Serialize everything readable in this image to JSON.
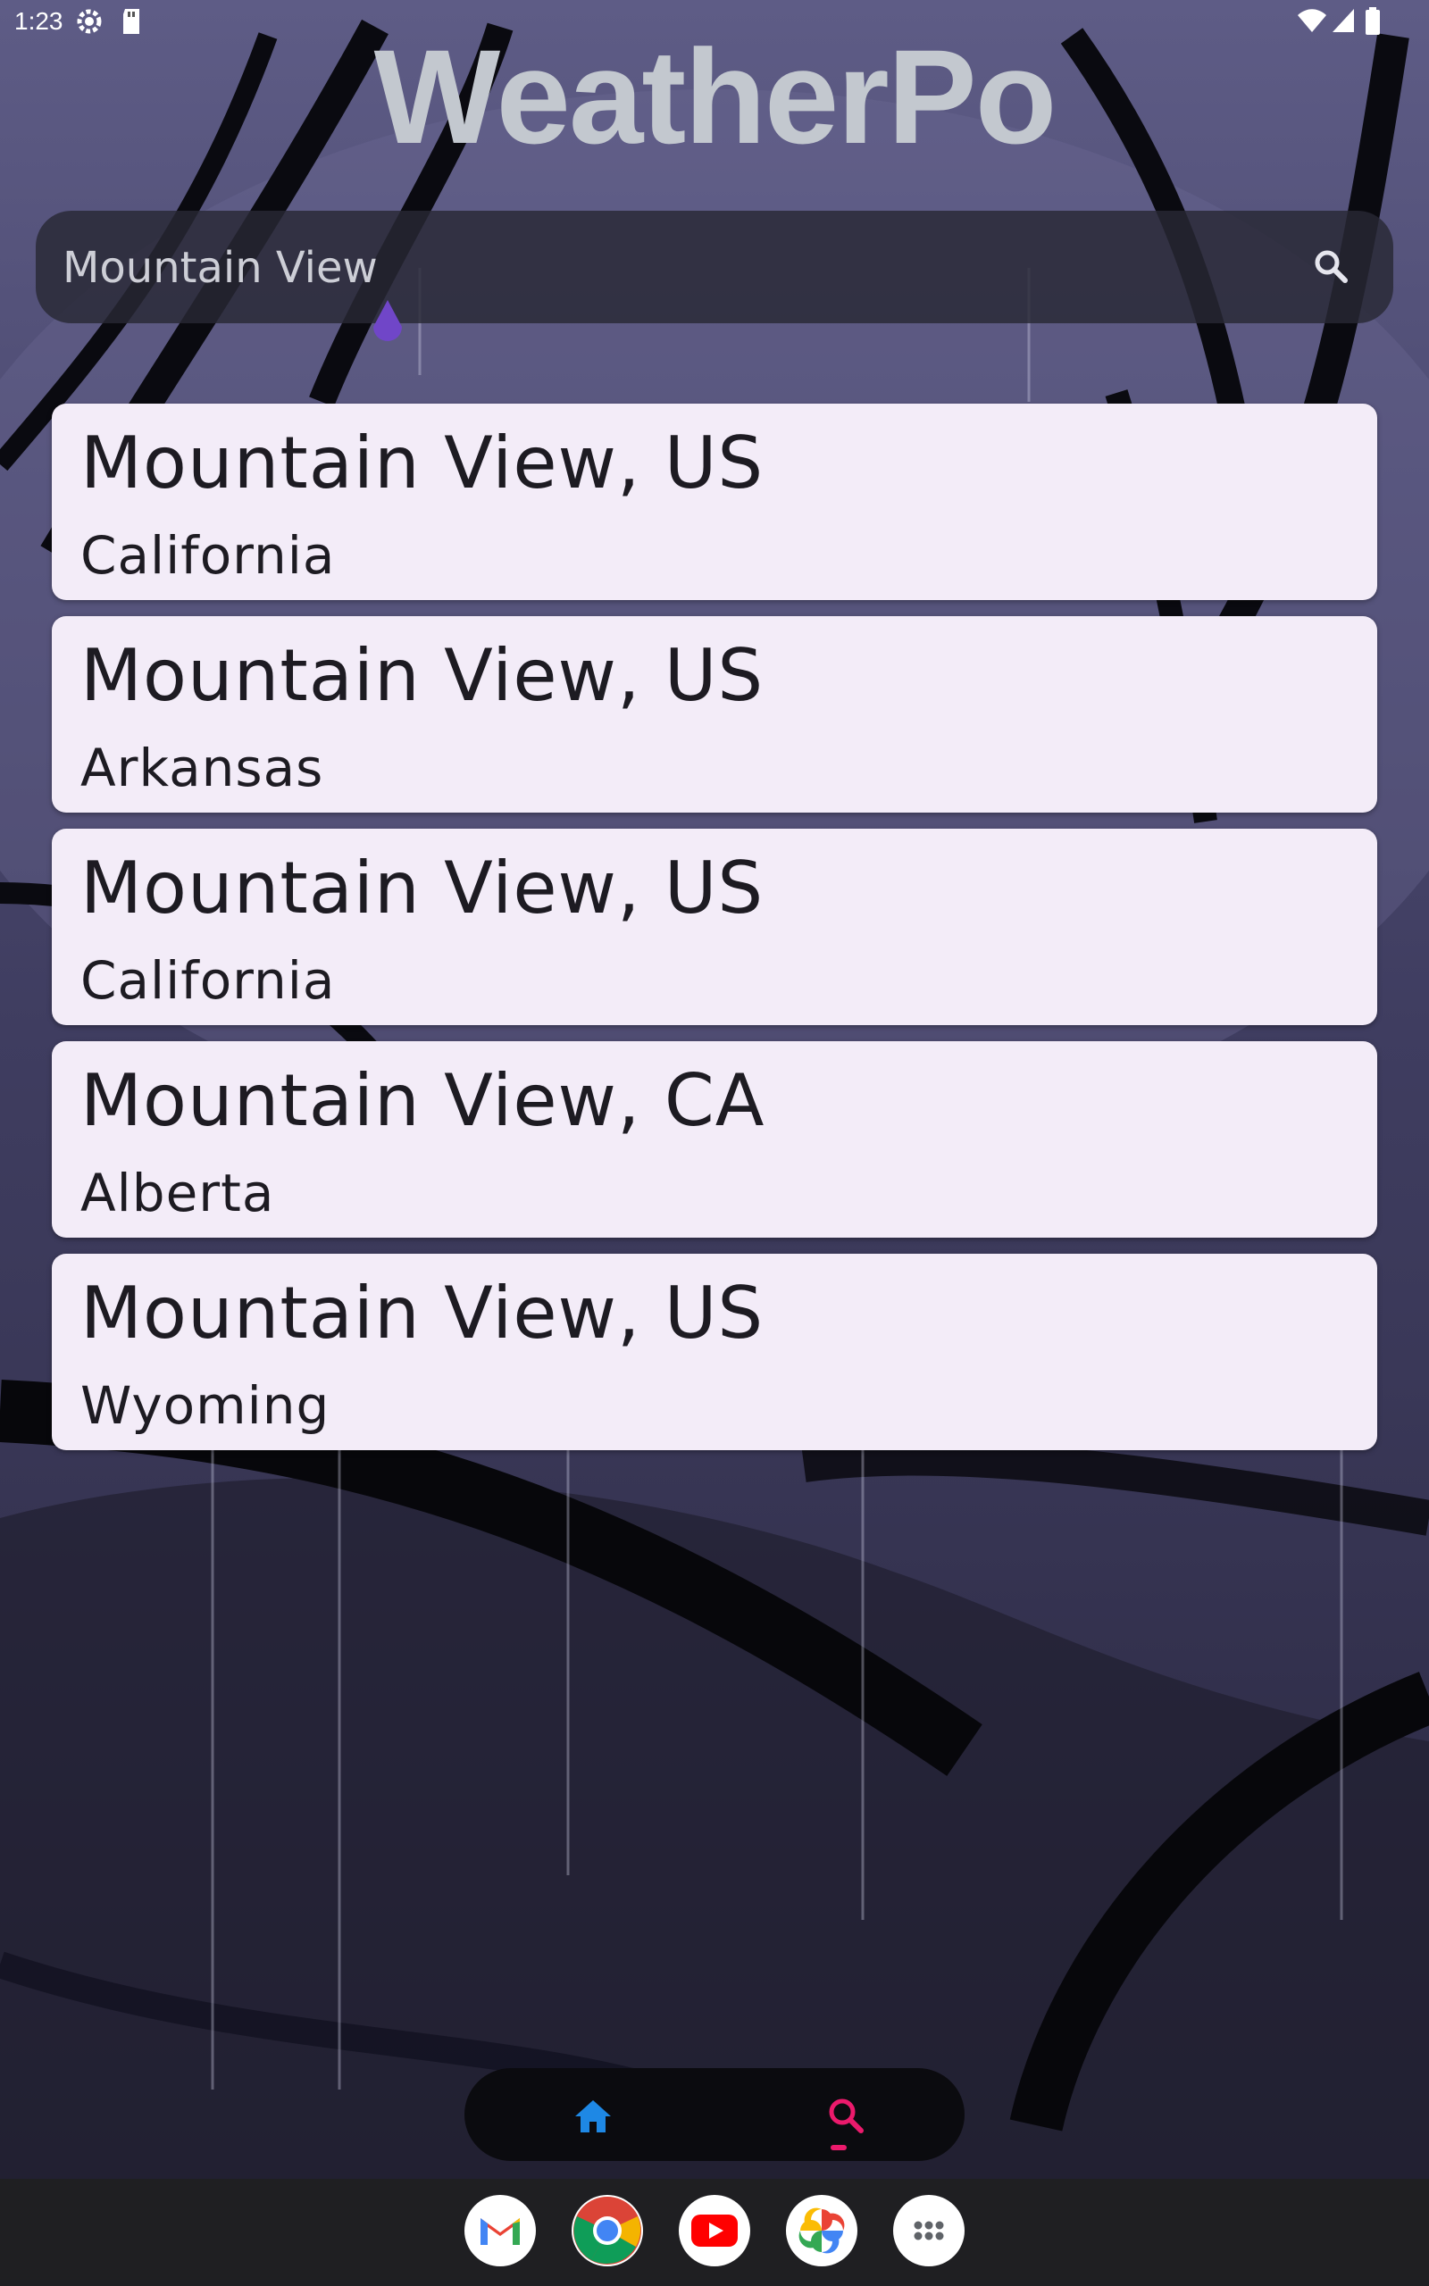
{
  "status_bar": {
    "time": "1:23",
    "left_icons": [
      "settings-icon",
      "sd-card-icon"
    ],
    "right_icons": [
      "wifi-icon",
      "signal-icon",
      "battery-icon"
    ]
  },
  "app": {
    "title": "WeatherPo"
  },
  "search": {
    "value": "Mountain View",
    "button_icon": "search-icon"
  },
  "results": [
    {
      "city": "Mountain View, US",
      "region": "California"
    },
    {
      "city": "Mountain View, US",
      "region": "Arkansas"
    },
    {
      "city": "Mountain View, US",
      "region": "California"
    },
    {
      "city": "Mountain View, CA",
      "region": "Alberta"
    },
    {
      "city": "Mountain View, US",
      "region": "Wyoming"
    }
  ],
  "bottom_nav": {
    "items": [
      {
        "icon": "home-icon",
        "color": "#1e88e5",
        "selected": false
      },
      {
        "icon": "search-icon",
        "color": "#ec1a6c",
        "selected": true
      }
    ]
  },
  "dock": {
    "apps": [
      "gmail-icon",
      "chrome-icon",
      "youtube-icon",
      "photos-icon",
      "app-drawer-icon"
    ]
  },
  "colors": {
    "card_bg": "#f3ecf8",
    "title": "#c3c8cf",
    "accent_search": "#ec1a6c",
    "accent_home": "#1e88e5",
    "cursor": "#7046c8"
  }
}
